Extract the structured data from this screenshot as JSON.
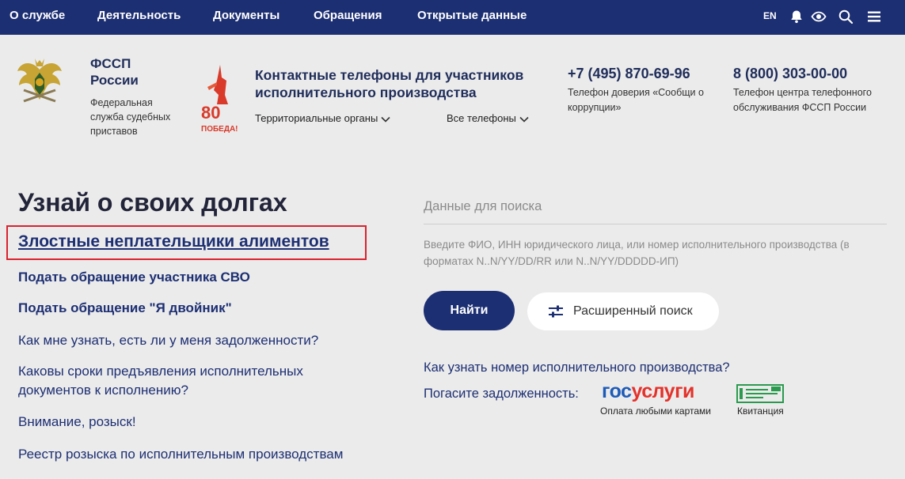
{
  "nav": {
    "items": [
      "О службе",
      "Деятельность",
      "Документы",
      "Обращения",
      "Открытые данные"
    ],
    "lang": "EN",
    "icons": [
      "bell-icon",
      "eye-icon",
      "search-icon",
      "menu-icon"
    ]
  },
  "header": {
    "org_title_1": "ФССП",
    "org_title_2": "России",
    "org_sub": "Федеральная служба судебных приставов",
    "pobeda_number": "80",
    "pobeda_word": "ПОБЕДА!",
    "contacts_title": "Контактные телефоны для участников исполнительного производства",
    "dropdown_regions": "Территориальные органы",
    "dropdown_phones": "Все телефоны",
    "phone1": "+7 (495) 870-69-96",
    "phone1_desc": "Телефон доверия «Сообщи о коррупции»",
    "phone2": "8 (800) 303-00-00",
    "phone2_desc": "Телефон центра телефонного обслуживания ФССП России"
  },
  "main": {
    "title": "Узнай о своих долгах",
    "link_main": "Злостные неплательщики алиментов",
    "links": [
      "Подать обращение участника СВО",
      "Подать обращение \"Я двойник\"",
      "Как мне узнать, есть ли у меня задолженности?",
      "Каковы сроки предъявления исполнительных документов к исполнению?",
      "Внимание, розыск!",
      "Реестр розыска по исполнительным производствам"
    ]
  },
  "search": {
    "label": "Данные для поиска",
    "hint": "Введите ФИО, ИНН юридического лица, или номер исполнительного производства (в форматах N..N/YY/DD/RR или N..N/YY/DDDDD-ИП)",
    "find_button": "Найти",
    "advanced_button": "Расширенный поиск",
    "howto_link": "Как узнать номер исполнительного производства?",
    "pay_label": "Погасите задолженность:",
    "gosuslugi_part1": "гос",
    "gosuslugi_part2": "услуги",
    "gosuslugi_sub": "Оплата любыми картами",
    "kvit_sub": "Квитанция"
  },
  "colors": {
    "nav_bg": "#1d2f73",
    "accent_red": "#d9232e",
    "gos_blue": "#1e5bb8",
    "gos_red": "#e4322b",
    "kvit_green": "#2a9a4e"
  }
}
